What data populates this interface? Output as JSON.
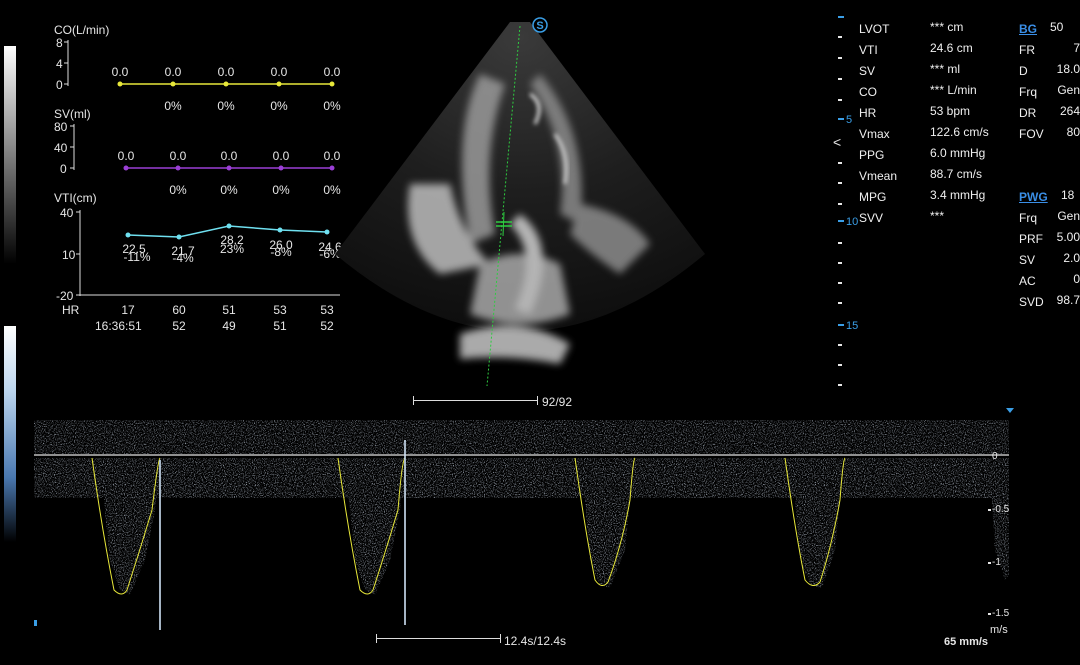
{
  "trend": {
    "co": {
      "title": "CO(L/min)",
      "ticks": [
        "8",
        "4",
        "0"
      ],
      "values": [
        "0.0",
        "0.0",
        "0.0",
        "0.0",
        "0.0"
      ],
      "pcts": [
        "0%",
        "0%",
        "0%",
        "0%"
      ],
      "color": "#e8e83a"
    },
    "sv": {
      "title": "SV(ml)",
      "ticks": [
        "80",
        "40",
        "0"
      ],
      "values": [
        "0.0",
        "0.0",
        "0.0",
        "0.0",
        "0.0"
      ],
      "pcts": [
        "0%",
        "0%",
        "0%",
        "0%"
      ],
      "color": "#9b3fd6"
    },
    "vti": {
      "title": "VTI(cm)",
      "ticks": [
        "40",
        "10",
        "-20"
      ],
      "values": [
        "22.5",
        "21.7",
        "28.2",
        "26.0",
        "24.6"
      ],
      "pcts": [
        "-11%",
        "-4%",
        "23%",
        "-8%",
        "-6%"
      ],
      "color": "#6fe0f0"
    },
    "hr_label": "HR",
    "hr_values": [
      "17",
      "60",
      "51",
      "53",
      "53"
    ],
    "time_label": "16:36:51",
    "row2_values": [
      "52",
      "49",
      "51",
      "52"
    ]
  },
  "measurements": [
    {
      "name": "LVOT",
      "value": "*** cm"
    },
    {
      "name": "VTI",
      "value": "24.6 cm"
    },
    {
      "name": "SV",
      "value": "*** ml"
    },
    {
      "name": "CO",
      "value": "*** L/min"
    },
    {
      "name": "HR",
      "value": "53 bpm"
    },
    {
      "name": "Vmax",
      "value": "122.6  cm/s"
    },
    {
      "name": "PPG",
      "value": "6.0  mmHg"
    },
    {
      "name": "Vmean",
      "value": "88.7  cm/s"
    },
    {
      "name": "MPG",
      "value": "3.4  mmHg"
    },
    {
      "name": "SVV",
      "value": "***"
    }
  ],
  "bmode_params": {
    "header": "BG",
    "header_value": "50",
    "rows": [
      {
        "name": "FR",
        "value": "7"
      },
      {
        "name": "D",
        "value": "18.0"
      },
      {
        "name": "Frq",
        "value": "Gen"
      },
      {
        "name": "DR",
        "value": "264"
      },
      {
        "name": "FOV",
        "value": "80"
      }
    ]
  },
  "pw_params": {
    "header": "PWG",
    "header_value": "18",
    "rows": [
      {
        "name": "Frq",
        "value": "Gen"
      },
      {
        "name": "PRF",
        "value": "5.00"
      },
      {
        "name": "SV",
        "value": "2.0"
      },
      {
        "name": "AC",
        "value": "0"
      },
      {
        "name": "SVD",
        "value": "98.7"
      }
    ]
  },
  "depth_scale": {
    "labels": [
      "5",
      "10",
      "15"
    ]
  },
  "cine_bmode": "92/92",
  "cine_doppler": "12.4s/12.4s",
  "velocity_scale": {
    "labels": [
      "0",
      "-0.5",
      "-1",
      "-1.5"
    ],
    "unit": "m/s"
  },
  "sweep_speed": "65 mm/s",
  "probe_marker": "S"
}
